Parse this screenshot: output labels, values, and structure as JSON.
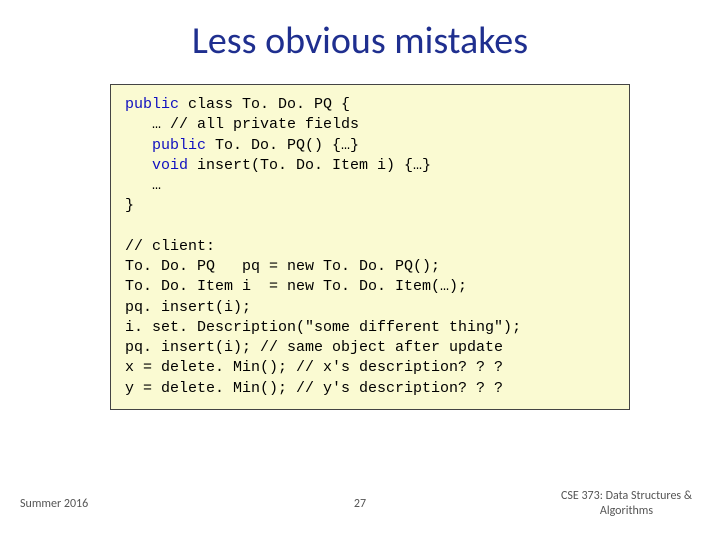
{
  "title": "Less obvious mistakes",
  "code": {
    "l1a": "public",
    "l1b": " class ",
    "l1c": "To. Do. PQ",
    "l1d": " {",
    "l2": "   … // all private fields",
    "l3a": "   public",
    "l3b": " To. Do. PQ() {…}",
    "l4a": "   void",
    "l4b": " insert(To. Do. Item i) {…}",
    "l5": "   …",
    "l6": "}",
    "blank": "",
    "l7": "// client:",
    "l8": "To. Do. PQ   pq = new To. Do. PQ();",
    "l9": "To. Do. Item i  = new To. Do. Item(…);",
    "l10": "pq. insert(i);",
    "l11": "i. set. Description(\"some different thing\");",
    "l12": "pq. insert(i); // same object after update",
    "l13": "x = delete. Min(); // x's description? ? ?",
    "l14": "y = delete. Min(); // y's description? ? ?"
  },
  "footer": {
    "left": "Summer 2016",
    "center": "27",
    "right_line1": "CSE 373: Data Structures &",
    "right_line2": "Algorithms"
  }
}
